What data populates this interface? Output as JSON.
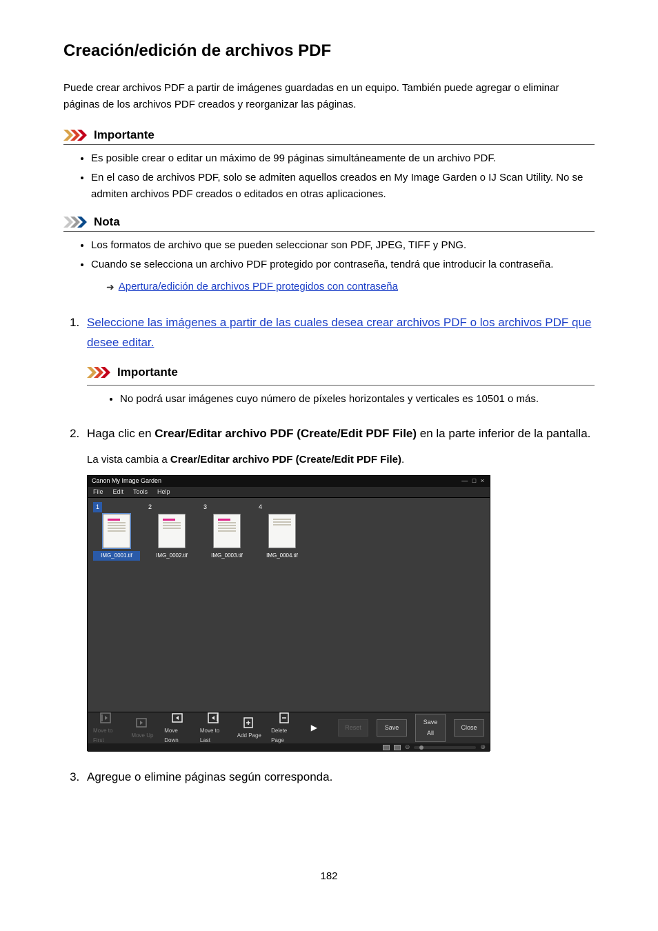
{
  "page_number": "182",
  "title": "Creación/edición de archivos PDF",
  "intro": "Puede crear archivos PDF a partir de imágenes guardadas en un equipo. También puede agregar o eliminar páginas de los archivos PDF creados y reorganizar las páginas.",
  "important_label": "Importante",
  "note_label": "Nota",
  "important_items": [
    "Es posible crear o editar un máximo de 99 páginas simultáneamente de un archivo PDF.",
    "En el caso de archivos PDF, solo se admiten aquellos creados en My Image Garden o IJ Scan Utility. No se admiten archivos PDF creados o editados en otras aplicaciones."
  ],
  "note_items": [
    "Los formatos de archivo que se pueden seleccionar son PDF, JPEG, TIFF y PNG.",
    "Cuando se selecciona un archivo PDF protegido por contraseña, tendrá que introducir la contraseña."
  ],
  "note_sublink": "Apertura/edición de archivos PDF protegidos con contraseña",
  "steps": {
    "s1_link": "Seleccione las imágenes a partir de las cuales desea crear archivos PDF o los archivos PDF que desee editar.",
    "s1_important_label": "Importante",
    "s1_important_item": "No podrá usar imágenes cuyo número de píxeles horizontales y verticales es 10501 o más.",
    "s2_pre": "Haga clic en ",
    "s2_bold": "Crear/Editar archivo PDF (Create/Edit PDF File)",
    "s2_post": " en la parte inferior de la pantalla.",
    "s2_caption_pre": "La vista cambia a ",
    "s2_caption_bold": "Crear/Editar archivo PDF (Create/Edit PDF File)",
    "s2_caption_post": ".",
    "s3": "Agregue o elimine páginas según corresponda."
  },
  "app": {
    "title": "Canon My Image Garden",
    "win_controls": "— □ ×",
    "menus": [
      "File",
      "Edit",
      "Tools",
      "Help"
    ],
    "thumbs": [
      {
        "idx": "1",
        "name": "IMG_0001.tif"
      },
      {
        "idx": "2",
        "name": "IMG_0002.tif"
      },
      {
        "idx": "3",
        "name": "IMG_0003.tif"
      },
      {
        "idx": "4",
        "name": "IMG_0004.tif"
      }
    ],
    "tools": {
      "move_first": "Move to First",
      "move_up": "Move Up",
      "move_down": "Move Down",
      "move_last": "Move to Last",
      "add_page": "Add Page",
      "delete_page": "Delete Page"
    },
    "buttons": {
      "reset": "Reset",
      "save": "Save",
      "save_all": "Save All",
      "close": "Close"
    }
  }
}
